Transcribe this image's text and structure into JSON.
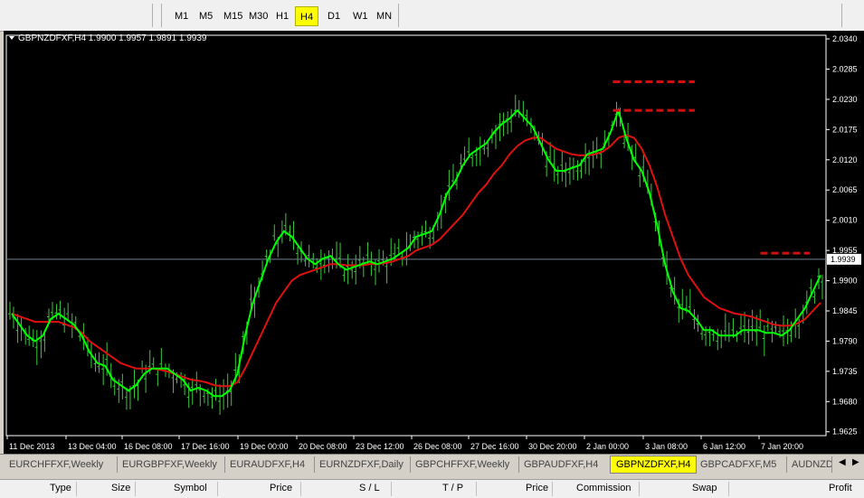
{
  "toolbar": {
    "timeframes": [
      "M1",
      "M5",
      "M15",
      "M30",
      "H1",
      "H4",
      "D1",
      "W1",
      "MN"
    ],
    "active": "H4"
  },
  "chart_header": "GBPNZDFXF,H4  1.9900 1.9957 1.9891 1.9939",
  "current_price_label": "1.9939",
  "tabs": [
    "EURCHFFXF,Weekly",
    "EURGBPFXF,Weekly",
    "EURAUDFXF,H4",
    "EURNZDFXF,Daily",
    "GBPCHFFXF,Weekly",
    "GBPAUDFXF,H4",
    "GBPNZDFXF,H4",
    "GBPCADFXF,M5",
    "AUDNZD"
  ],
  "active_tab": "GBPNZDFXF,H4",
  "terminal_columns": [
    "Type",
    "Size",
    "Symbol",
    "Price",
    "S / L",
    "T / P",
    "Price",
    "Commission",
    "Swap",
    "Profit"
  ],
  "colors": {
    "background": "#000000",
    "bars": "#3cc83c",
    "ma_fast": "#00ff00",
    "ma_slow": "#e01010",
    "levels": "#d01010",
    "price_line": "#708090"
  },
  "chart_data": {
    "type": "line",
    "symbol": "GBPNZDFXF",
    "timeframe": "H4",
    "ohlc_header": {
      "open": 1.99,
      "high": 1.9957,
      "low": 1.9891,
      "close": 1.9939
    },
    "y_ticks": [
      2.034,
      2.0285,
      2.023,
      2.0175,
      2.012,
      2.0065,
      2.001,
      1.9955,
      1.99,
      1.9845,
      1.979,
      1.9735,
      1.968,
      1.9625
    ],
    "ylim": [
      1.9618,
      2.0345
    ],
    "x_tick_labels": [
      "11 Dec 2013",
      "13 Dec 04:00",
      "16 Dec 08:00",
      "17 Dec 16:00",
      "19 Dec 00:00",
      "20 Dec 08:00",
      "23 Dec 12:00",
      "26 Dec 08:00",
      "27 Dec 16:00",
      "30 Dec 20:00",
      "2 Jan 00:00",
      "3 Jan 08:00",
      "6 Jan 12:00",
      "7 Jan 20:00"
    ],
    "current_price": 1.9939,
    "series": [
      {
        "values": [
          1.984,
          1.982,
          1.98,
          1.979,
          1.98,
          1.983,
          1.984,
          1.983,
          1.982,
          1.98,
          1.977,
          1.975,
          1.9745,
          1.972,
          1.971,
          1.97,
          1.971,
          1.973,
          1.974,
          1.974,
          1.974,
          1.973,
          1.972,
          1.97,
          1.9705,
          1.97,
          1.969,
          1.969,
          1.97,
          1.973,
          1.98,
          1.986,
          1.99,
          1.994,
          1.997,
          1.999,
          1.998,
          1.996,
          1.994,
          1.993,
          1.994,
          1.9945,
          1.993,
          1.992,
          1.9925,
          1.993,
          1.9935,
          1.993,
          1.9935,
          1.994,
          1.995,
          1.996,
          1.998,
          1.9985,
          1.999,
          2.002,
          2.006,
          2.008,
          2.011,
          2.013,
          2.014,
          2.015,
          2.017,
          2.0185,
          2.0195,
          2.021,
          2.0195,
          2.018,
          2.015,
          2.012,
          2.01,
          2.01,
          2.0105,
          2.011,
          2.013,
          2.0135,
          2.014,
          2.017,
          2.021,
          2.016,
          2.012,
          2.01,
          2.006,
          2.0,
          1.993,
          1.988,
          1.985,
          1.9845,
          1.983,
          1.981,
          1.981,
          1.98,
          1.98,
          1.98,
          1.981,
          1.981,
          1.981,
          1.9805,
          1.9805,
          1.98,
          1.981,
          1.983,
          1.985,
          1.988,
          1.991
        ]
      },
      {
        "values": [
          1.984,
          1.9835,
          1.983,
          1.9825,
          1.9825,
          1.9825,
          1.9825,
          1.982,
          1.9815,
          1.9805,
          1.979,
          1.978,
          1.977,
          1.976,
          1.975,
          1.9745,
          1.974,
          1.974,
          1.974,
          1.9738,
          1.9735,
          1.973,
          1.9725,
          1.972,
          1.9718,
          1.9715,
          1.971,
          1.9708,
          1.9708,
          1.9715,
          1.974,
          1.977,
          1.98,
          1.983,
          1.986,
          1.988,
          1.99,
          1.991,
          1.9915,
          1.992,
          1.9925,
          1.993,
          1.993,
          1.9928,
          1.9928,
          1.9928,
          1.993,
          1.993,
          1.9932,
          1.9935,
          1.994,
          1.9945,
          1.9955,
          1.996,
          1.9965,
          1.9975,
          1.999,
          2.0005,
          2.002,
          2.004,
          2.006,
          2.0075,
          2.0095,
          2.011,
          2.013,
          2.0145,
          2.0155,
          2.016,
          2.016,
          2.015,
          2.014,
          2.0135,
          2.013,
          2.0128,
          2.0128,
          2.013,
          2.0135,
          2.0145,
          2.016,
          2.0165,
          2.016,
          2.014,
          2.011,
          2.007,
          2.002,
          1.998,
          1.994,
          1.991,
          1.989,
          1.987,
          1.986,
          1.985,
          1.9845,
          1.984,
          1.9838,
          1.9835,
          1.983,
          1.9825,
          1.982,
          1.9818,
          1.9818,
          1.9822,
          1.983,
          1.9845,
          1.986
        ]
      }
    ],
    "levels": [
      {
        "price": 2.0262,
        "from_frac": 0.74,
        "to_frac": 0.84
      },
      {
        "price": 2.021,
        "from_frac": 0.74,
        "to_frac": 0.84
      },
      {
        "price": 1.995,
        "from_frac": 0.92,
        "to_frac": 0.98
      }
    ]
  }
}
